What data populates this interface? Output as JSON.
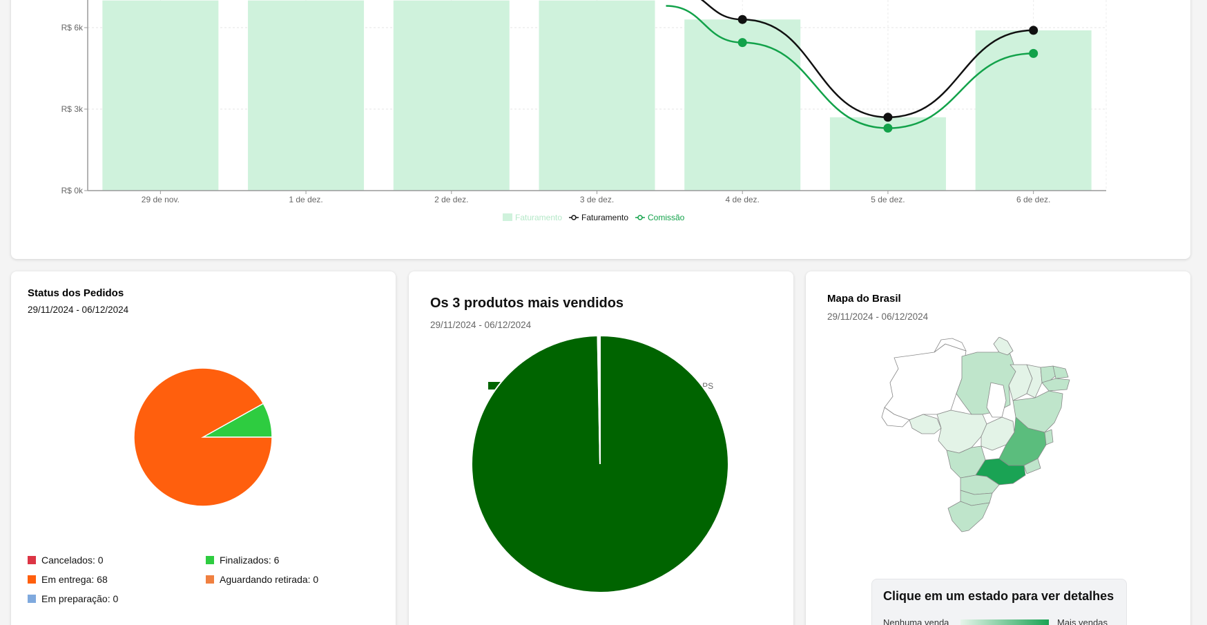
{
  "chart_data": [
    {
      "type": "bar",
      "categories": [
        "29 de nov.",
        "1 de dez.",
        "2 de dez.",
        "3 de dez.",
        "4 de dez.",
        "5 de dez.",
        "6 de dez."
      ],
      "series": [
        {
          "name": "Faturamento",
          "kind": "bar",
          "values": [
            7000,
            7000,
            7000,
            7000,
            6300,
            2700,
            5900
          ]
        },
        {
          "name": "Faturamento",
          "kind": "line",
          "values": [
            null,
            null,
            null,
            null,
            6300,
            2700,
            5900
          ]
        },
        {
          "name": "Comissão",
          "kind": "line",
          "values": [
            null,
            null,
            null,
            null,
            5450,
            2300,
            5050
          ]
        }
      ],
      "yticks": [
        "R$ 0k",
        "R$ 3k",
        "R$ 6k"
      ],
      "ylim": [
        0,
        7000
      ],
      "grid": true,
      "legend": "bottom-center",
      "colors": {
        "bar": "#cff2dc",
        "bar_legend_text": "#b5e8c8",
        "line1": "#111111",
        "line2": "#12a24a"
      }
    },
    {
      "type": "pie",
      "title": "Status dos Pedidos",
      "subtitle": "29/11/2024 - 06/12/2024",
      "slices": [
        {
          "label": "Cancelados",
          "value": 0,
          "color": "#dc3545",
          "legend": "Cancelados: 0"
        },
        {
          "label": "Finalizados",
          "value": 6,
          "color": "#2ecc40",
          "legend": "Finalizados: 6"
        },
        {
          "label": "Em entrega",
          "value": 68,
          "color": "#ff5f0d",
          "legend": "Em entrega: 68"
        },
        {
          "label": "Aguardando retirada",
          "value": 0,
          "color": "#f08040",
          "legend": "Aguardando retirada: 0"
        },
        {
          "label": "Em preparação",
          "value": 0,
          "color": "#7fa9de",
          "legend": "Em preparação: 0"
        }
      ]
    },
    {
      "type": "pie",
      "title": "Os 3 produtos mais vendidos",
      "subtitle": "29/11/2024 - 06/12/2024",
      "slices": [
        {
          "label": "GLICO STOP 30ml",
          "value": 99.7,
          "color": "#006400"
        },
        {
          "label": "ARTTICURE 60 CAPS",
          "value": 0.15,
          "color": "#3cb371"
        },
        {
          "label": "GEL ARTTICURE 120 gr",
          "value": 0.15,
          "color": "#00ff00"
        }
      ]
    }
  ],
  "map": {
    "title": "Mapa do Brasil",
    "subtitle": "29/11/2024 - 06/12/2024",
    "tooltip_title": "Clique em um estado para ver detalhes",
    "ramp_low": "Nenhuma venda",
    "ramp_high": "Mais vendas",
    "colors": {
      "empty": "#ffffff",
      "light": "#e3f3e7",
      "mid": "#bfe5cb",
      "strong": "#5bbd7d",
      "max": "#1aa354"
    }
  }
}
